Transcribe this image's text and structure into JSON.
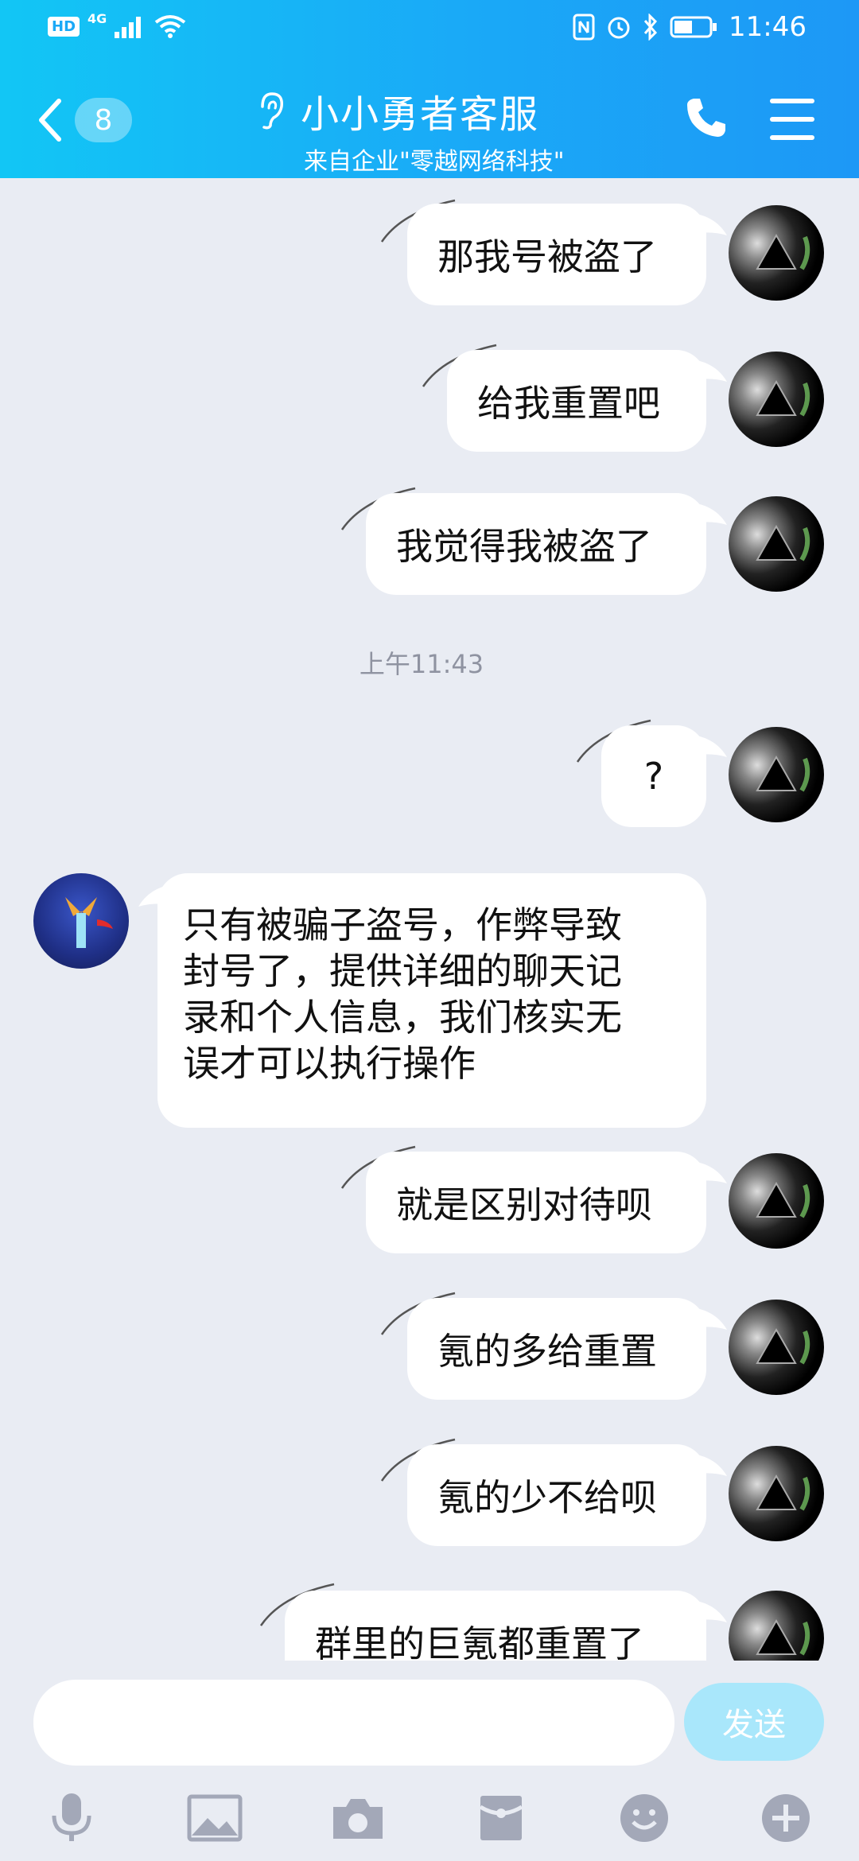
{
  "status_bar": {
    "hd": "HD",
    "network": "4G",
    "time": "11:46"
  },
  "header": {
    "unread_count": "8",
    "title": "小小勇者客服",
    "subtitle": "来自企业\"零越网络科技\""
  },
  "messages": [
    {
      "side": "right",
      "text": "那我号被盗了"
    },
    {
      "side": "right",
      "text": "给我重置吧"
    },
    {
      "side": "right",
      "text": "我觉得我被盗了"
    },
    {
      "type": "timestamp",
      "text": "上午11:43"
    },
    {
      "side": "right",
      "text": "?"
    },
    {
      "side": "left",
      "lines": [
        "只有被骗子盗号，作弊导致",
        "封号了，提供详细的聊天记",
        "录和个人信息，我们核实无",
        "误才可以执行操作"
      ]
    },
    {
      "side": "right",
      "text": "就是区别对待呗"
    },
    {
      "side": "right",
      "text": "氪的多给重置"
    },
    {
      "side": "right",
      "text": "氪的少不给呗"
    },
    {
      "side": "right",
      "text": "群里的巨氪都重置了"
    }
  ],
  "composer": {
    "send_label": "发送"
  },
  "colors": {
    "header_gradient_start": "#12c6f5",
    "header_gradient_end": "#1d98f6",
    "chat_background": "#e9ecf3",
    "send_button": "#a9e7fb",
    "icon_gray": "#a3a8b8"
  }
}
